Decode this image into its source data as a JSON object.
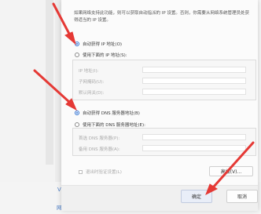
{
  "description": "如果网络支持此功能，则可以获取自动指派的 IP 设置。否则，你需要从网络系统管理员处获得适当的 IP 设置。",
  "ip_options": [
    {
      "label": "自动获得 IP 地址(O)",
      "selected": true
    },
    {
      "label": "使用下面的 IP 地址(S):",
      "selected": false
    }
  ],
  "ip_fields": [
    "IP 地址(I):",
    "子网掩码(U):",
    "默认网关(D):"
  ],
  "dns_options": [
    {
      "label": "自动获得 DNS 服务器地址(B)",
      "selected": true
    },
    {
      "label": "使用下面的 DNS 服务器地址(E):",
      "selected": false
    }
  ],
  "dns_fields": [
    "首选 DNS 服务器(P):",
    "备用 DNS 服务器(A):"
  ],
  "exit_validate_label": "退出时验证设置(L)",
  "advanced_button": "高级(V)...",
  "ok_button": "确定",
  "cancel_button": "取消",
  "side_link_v": "V",
  "network_reset_link": "网络重置",
  "colors": {
    "accent": "#2c6fd1",
    "annotation_arrow": "#e53935",
    "link": "#4a7cc6"
  }
}
